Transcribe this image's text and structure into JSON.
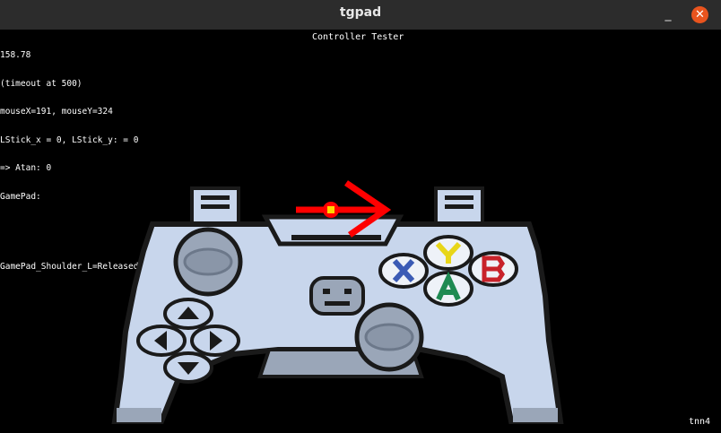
{
  "window": {
    "title": "tgpad",
    "minimize_glyph": "_",
    "close_glyph": "✕"
  },
  "screen": {
    "header_title": "Controller Tester",
    "log_lines": [
      "158.78",
      "(timeout at 500)",
      "mouseX=191, mouseY=324",
      "LStick_x = 0, LStick_y: = 0",
      "=> Atan: 0",
      "GamePad:"
    ],
    "shoulder_status": "GamePad_Shoulder_L=Released, GamePad_Shoulder_R=Released",
    "corner_label": "tnn4"
  },
  "controller": {
    "buttons": {
      "x": {
        "icon": "x-button-icon",
        "color": "#3b5bb5"
      },
      "y": {
        "icon": "y-button-icon",
        "color": "#e8d619"
      },
      "a": {
        "icon": "a-button-icon",
        "color": "#1e8a52"
      },
      "b": {
        "icon": "b-button-icon",
        "color": "#c8222a"
      }
    },
    "arrow_color": "#ff0000",
    "body_color": "#c8d6ec",
    "outline_color": "#1a1a1a"
  }
}
